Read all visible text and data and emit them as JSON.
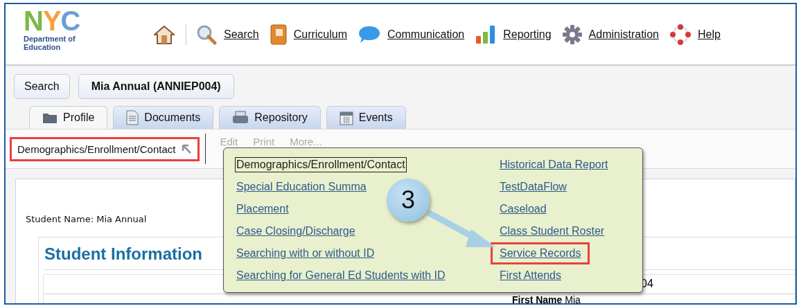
{
  "logo": {
    "letters": [
      {
        "text": "N",
        "color": "#7cb749"
      },
      {
        "text": "Y",
        "color": "#f6a03c"
      },
      {
        "text": "C",
        "color": "#6b9fd6"
      }
    ],
    "lines": [
      "Department of",
      "Education"
    ]
  },
  "nav": [
    {
      "kind": "home"
    },
    {
      "kind": "link",
      "label": "Search"
    },
    {
      "kind": "link",
      "label": "Curriculum"
    },
    {
      "kind": "link",
      "label": "Communication"
    },
    {
      "kind": "link",
      "label": "Reporting"
    },
    {
      "kind": "link",
      "label": "Administration"
    },
    {
      "kind": "link",
      "label": "Help"
    }
  ],
  "breadcrumb": [
    {
      "label": "Search",
      "current": false
    },
    {
      "label": "Mia Annual (ANNIEP004)",
      "current": true
    }
  ],
  "tabs": [
    {
      "label": "Profile",
      "selected": true
    },
    {
      "label": "Documents",
      "selected": false
    },
    {
      "label": "Repository",
      "selected": false
    },
    {
      "label": "Events",
      "selected": false
    }
  ],
  "view_select": {
    "value": "Demographics/Enrollment/Contact",
    "highlighted": true
  },
  "toolbar": [
    "Edit",
    "Print",
    "More..."
  ],
  "menu": {
    "columns": [
      [
        {
          "label": "Demographics/Enrollment/Contact",
          "focused": true,
          "highlighted": false
        },
        {
          "label": "Special Education Summa",
          "focused": false,
          "highlighted": false
        },
        {
          "label": "Placement",
          "focused": false,
          "highlighted": false
        },
        {
          "label": "Case Closing/Discharge",
          "focused": false,
          "highlighted": false
        },
        {
          "label": "Searching with or without ID",
          "focused": false,
          "highlighted": false
        },
        {
          "label": "Searching for General Ed Students with ID",
          "focused": false,
          "highlighted": false
        }
      ],
      [
        {
          "label": "Historical Data Report",
          "focused": false,
          "highlighted": false
        },
        {
          "label": "TestDataFlow",
          "focused": false,
          "highlighted": false
        },
        {
          "label": "Caseload",
          "focused": false,
          "highlighted": false
        },
        {
          "label": "Class Student Roster",
          "focused": false,
          "highlighted": false
        },
        {
          "label": "Service Records",
          "focused": false,
          "highlighted": true
        },
        {
          "label": "First Attends",
          "focused": false,
          "highlighted": false
        }
      ]
    ]
  },
  "callout": {
    "number": "3"
  },
  "student": {
    "name_label": "Student Name:",
    "name": "Mia Annual",
    "section_title": "Student Information",
    "id_fragment": "04",
    "first_name_label": "First Name",
    "first_name": "Mia"
  }
}
